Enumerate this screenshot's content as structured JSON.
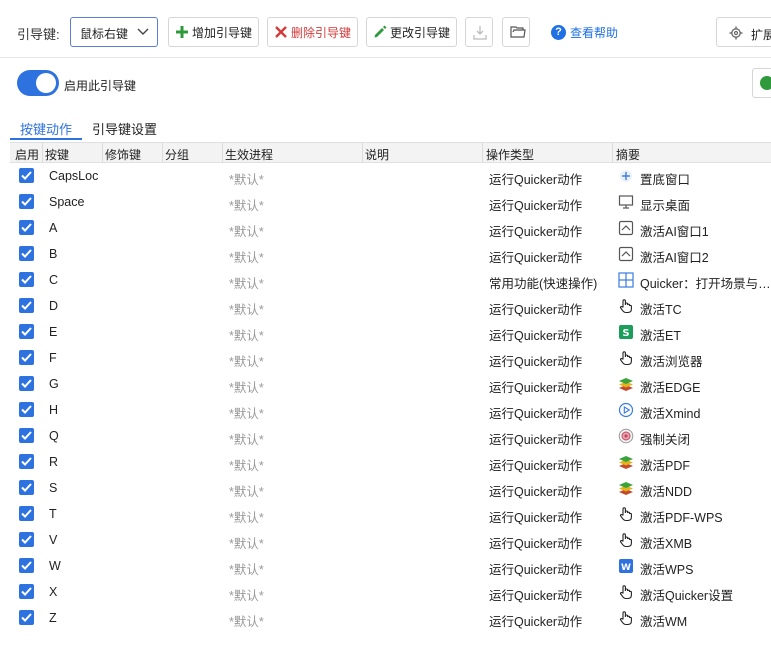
{
  "toolbar": {
    "guide_key_label": "引导键:",
    "guide_key_value": "鼠标右键",
    "add_label": "增加引导键",
    "delete_label": "删除引导键",
    "edit_label": "更改引导键",
    "help_label": "查看帮助",
    "extend_label": "扩展"
  },
  "enable": {
    "label": "启用此引导键",
    "on": true
  },
  "tabs": [
    {
      "label": "按键动作",
      "active": true
    },
    {
      "label": "引导键设置",
      "active": false
    }
  ],
  "table": {
    "headers": [
      "启用",
      "按键",
      "修饰键",
      "分组",
      "生效进程",
      "说明",
      "操作类型",
      "摘要"
    ],
    "rows": [
      {
        "enabled": true,
        "key": "CapsLoc",
        "process": "*默认*",
        "type": "运行Quicker动作",
        "icon": "pin-icon",
        "summary": "置底窗口"
      },
      {
        "enabled": true,
        "key": "Space",
        "process": "*默认*",
        "type": "运行Quicker动作",
        "icon": "monitor-icon",
        "summary": "显示桌面"
      },
      {
        "enabled": true,
        "key": "A",
        "process": "*默认*",
        "type": "运行Quicker动作",
        "icon": "window-icon",
        "summary": "激活AI窗口1"
      },
      {
        "enabled": true,
        "key": "B",
        "process": "*默认*",
        "type": "运行Quicker动作",
        "icon": "window-icon",
        "summary": "激活AI窗口2"
      },
      {
        "enabled": true,
        "key": "C",
        "process": "*默认*",
        "type": "常用功能(快速操作)",
        "icon": "grid-icon",
        "summary": "Quicker：打开场景与…"
      },
      {
        "enabled": true,
        "key": "D",
        "process": "*默认*",
        "type": "运行Quicker动作",
        "icon": "hand-icon",
        "summary": "激活TC"
      },
      {
        "enabled": true,
        "key": "E",
        "process": "*默认*",
        "type": "运行Quicker动作",
        "icon": "s-app-icon",
        "summary": "激活ET"
      },
      {
        "enabled": true,
        "key": "F",
        "process": "*默认*",
        "type": "运行Quicker动作",
        "icon": "hand-icon",
        "summary": "激活浏览器"
      },
      {
        "enabled": true,
        "key": "G",
        "process": "*默认*",
        "type": "运行Quicker动作",
        "icon": "layers-icon",
        "summary": "激活EDGE"
      },
      {
        "enabled": true,
        "key": "H",
        "process": "*默认*",
        "type": "运行Quicker动作",
        "icon": "play-circle-icon",
        "summary": "激活Xmind"
      },
      {
        "enabled": true,
        "key": "Q",
        "process": "*默认*",
        "type": "运行Quicker动作",
        "icon": "target-icon",
        "summary": "强制关闭"
      },
      {
        "enabled": true,
        "key": "R",
        "process": "*默认*",
        "type": "运行Quicker动作",
        "icon": "layers-icon",
        "summary": "激活PDF"
      },
      {
        "enabled": true,
        "key": "S",
        "process": "*默认*",
        "type": "运行Quicker动作",
        "icon": "layers-icon",
        "summary": "激活NDD"
      },
      {
        "enabled": true,
        "key": "T",
        "process": "*默认*",
        "type": "运行Quicker动作",
        "icon": "hand-icon",
        "summary": "激活PDF-WPS"
      },
      {
        "enabled": true,
        "key": "V",
        "process": "*默认*",
        "type": "运行Quicker动作",
        "icon": "hand-icon",
        "summary": "激活XMB"
      },
      {
        "enabled": true,
        "key": "W",
        "process": "*默认*",
        "type": "运行Quicker动作",
        "icon": "wps-icon",
        "summary": "激活WPS"
      },
      {
        "enabled": true,
        "key": "X",
        "process": "*默认*",
        "type": "运行Quicker动作",
        "icon": "hand-icon",
        "summary": "激活Quicker设置"
      },
      {
        "enabled": true,
        "key": "Z",
        "process": "*默认*",
        "type": "运行Quicker动作",
        "icon": "hand-icon",
        "summary": "激活WM"
      }
    ]
  }
}
